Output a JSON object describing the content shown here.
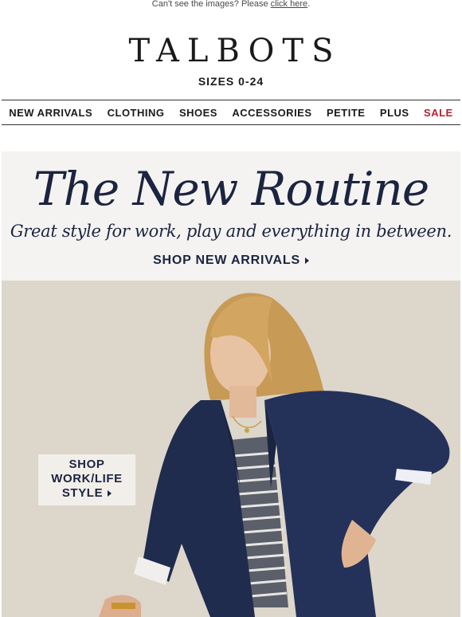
{
  "preheader": {
    "text": "Can't see the images? Please ",
    "link": "click here",
    "suffix": "."
  },
  "brand": {
    "logo": "TALBOTS",
    "tagline": "SIZES 0-24"
  },
  "nav": {
    "items": [
      "NEW ARRIVALS",
      "CLOTHING",
      "SHOES",
      "ACCESSORIES",
      "PETITE",
      "PLUS",
      "SALE"
    ],
    "sale_color": "#b3232e"
  },
  "hero": {
    "headline": "The New Routine",
    "subline": "Great style for work, play and everything in between.",
    "cta": "SHOP NEW ARRIVALS",
    "overlay_cta_line1": "SHOP",
    "overlay_cta_line2": "WORK/LIFE",
    "overlay_cta_line3": "STYLE"
  },
  "colors": {
    "navy": "#1b2440",
    "backdrop": "#ddd6cb"
  }
}
